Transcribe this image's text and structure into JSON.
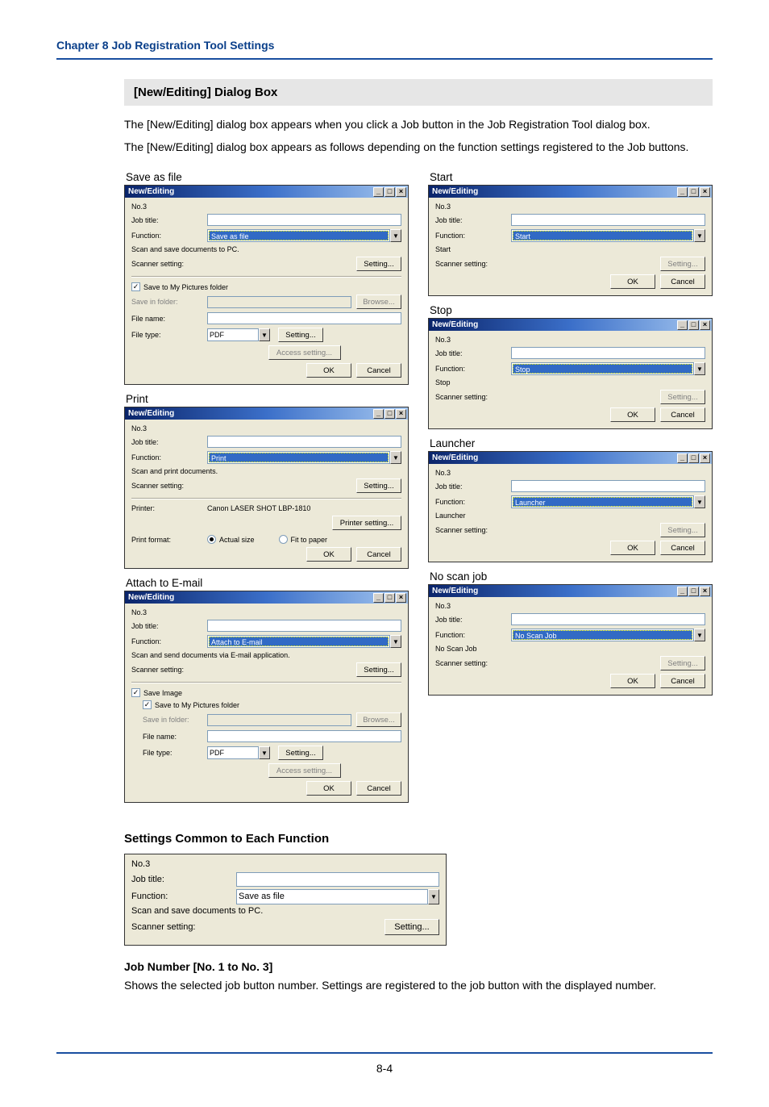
{
  "header": {
    "chapter": "Chapter 8   Job Registration Tool Settings"
  },
  "section": {
    "title": "[New/Editing] Dialog Box",
    "para1": "The [New/Editing] dialog box appears when you click a Job button in the Job Registration Tool dialog box.",
    "para2": "The [New/Editing] dialog box appears as follows depending on the function settings registered to the Job buttons."
  },
  "captions": {
    "save_as_file": "Save as file",
    "print": "Print",
    "attach_email": "Attach to E-mail",
    "start": "Start",
    "stop": "Stop",
    "launcher": "Launcher",
    "noscan": "No scan job"
  },
  "dlg": {
    "title": "New/Editing",
    "no": "No.3",
    "job_title": "Job title:",
    "function": "Function:",
    "scan_save_pc": "Scan and save documents to PC.",
    "scanner_setting": "Scanner setting:",
    "setting_btn": "Setting...",
    "save_myp": "Save to My Pictures folder",
    "save_in_folder": "Save in folder:",
    "browse_btn": "Browse...",
    "file_name": "File name:",
    "file_type": "File type:",
    "access_setting": "Access setting...",
    "ok": "OK",
    "cancel": "Cancel",
    "pdf": "PDF",
    "print_desc": "Scan and print documents.",
    "printer": "Printer:",
    "printer_name": "Canon LASER SHOT LBP-1810",
    "printer_setting": "Printer setting...",
    "print_format": "Print format:",
    "actual_size": "Actual size",
    "fit_paper": "Fit to paper",
    "attach_desc": "Scan and send documents via E-mail application.",
    "save_image": "Save Image",
    "start_desc": "Start",
    "stop_desc": "Stop",
    "launcher_desc": "Launcher",
    "noscan_desc": "No Scan Job",
    "func_save": "Save as file",
    "func_print": "Print",
    "func_attach": "Attach to E-mail",
    "func_start": "Start",
    "func_stop": "Stop",
    "func_launcher": "Launcher",
    "func_noscan": "No Scan Job"
  },
  "common": {
    "heading": "Settings Common to Each Function",
    "no": "No.3",
    "job_title": "Job title:",
    "function": "Function:",
    "func_val": "Save as file",
    "desc": "Scan and save documents to PC.",
    "scanner_setting": "Scanner setting:",
    "setting_btn": "Setting..."
  },
  "jobnum": {
    "heading": "Job Number [No. 1 to No. 3]",
    "text": "Shows the selected job button number. Settings are registered to the job button with the displayed number."
  },
  "pagenum": "8-4"
}
